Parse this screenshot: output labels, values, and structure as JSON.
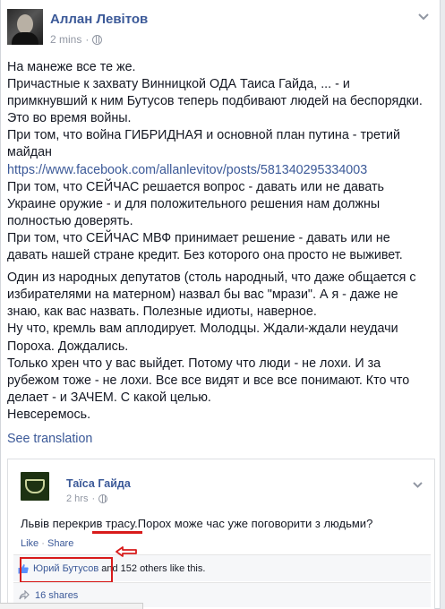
{
  "post": {
    "author": "Аллан Левітов",
    "time": "2 mins",
    "paragraphs": [
      "На манеже все те же.",
      "Причастные к захвату Винницкой ОДА Таиса Гайда, ... - и примкнувший к ним Бутусов теперь подбивают людей на беспорядки. Это во время войны.",
      "При том, что война ГИБРИДНАЯ и основной план путина - третий майдан"
    ],
    "link": "https://www.facebook.com/allanlevitov/posts/581340295334003",
    "paragraphs_after_link": [
      "При том, что СЕЙЧАС решается вопрос - давать или не давать Украине оружие - и для положительного решения нам должны полностью доверять.",
      "При том, что СЕЙЧАС МВФ принимает решение - давать или не давать нашей стране кредит. Без которого она просто не выживет."
    ],
    "second_block": [
      "Один из народных депутатов (столь народный, что даже общается с избирателями на матерном) назвал бы вас \"мрази\". А я - даже не знаю, как вас назвать. Полезные идиоты, наверное.",
      "Ну что, кремль вам аплодирует. Молодцы. Ждали-ждали неудачи Пороха. Дождались.",
      "Только хрен что у вас выйдет. Потому что люди - не лохи. И за рубежом тоже - не лохи. Все все видят и все все понимают. Кто что делает - и ЗАЧЕМ. С какой целью.",
      "Невсеремось."
    ],
    "see_translation": "See translation"
  },
  "shared": {
    "author": "Таїса Гайда",
    "time": "2 hrs",
    "text": "Львів перекрив трасу.Порох може час уже поговорити з людьми?",
    "like_label": "Like",
    "share_label": "Share",
    "dot": "·",
    "likes_name": "Юрий Бутусов",
    "likes_rest": "and 152 others like this.",
    "shares": "16 shares"
  },
  "icons": {
    "globe": "globe-icon",
    "chevron": "chevron-down-icon",
    "thumb": "thumbs-up-icon",
    "share": "share-arrow-icon"
  },
  "colors": {
    "link": "#3b5998",
    "annotation": "#d81b1b"
  }
}
